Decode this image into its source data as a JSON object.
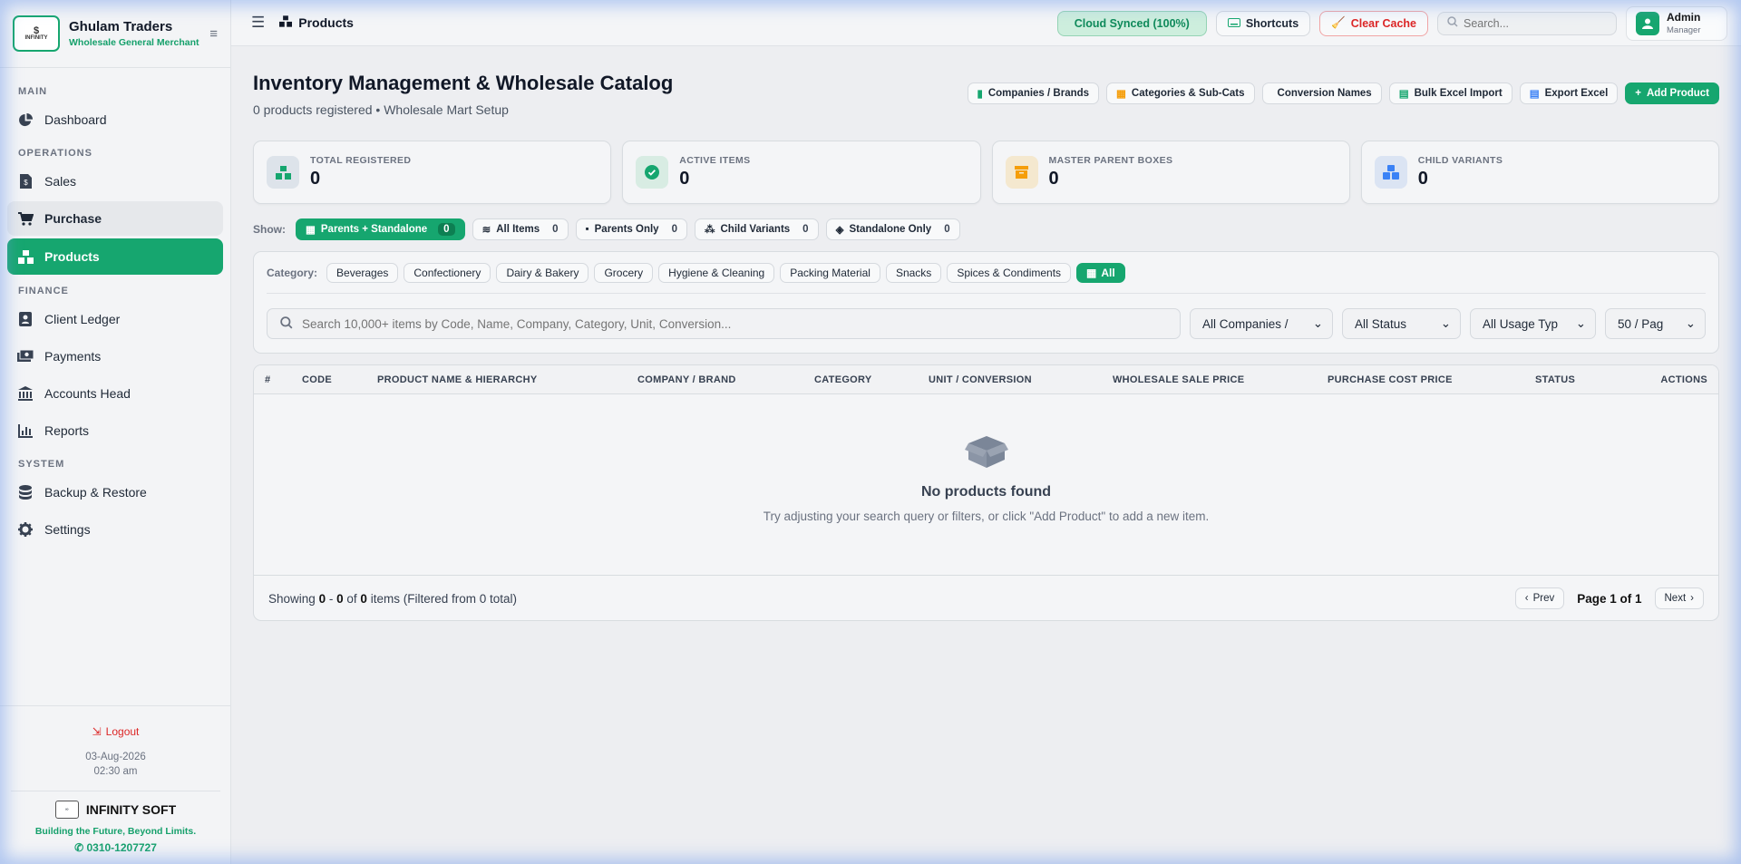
{
  "brand": {
    "name": "Ghulam Traders",
    "subtitle": "Wholesale General Merchant",
    "logo_text": "INFINITY"
  },
  "sidebar": {
    "sections": {
      "main": "MAIN",
      "operations": "OPERATIONS",
      "finance": "FINANCE",
      "system": "SYSTEM"
    },
    "items": {
      "dashboard": "Dashboard",
      "sales": "Sales",
      "purchase": "Purchase",
      "products": "Products",
      "client_ledger": "Client Ledger",
      "payments": "Payments",
      "accounts_head": "Accounts Head",
      "reports": "Reports",
      "backup": "Backup & Restore",
      "settings": "Settings"
    },
    "logout": "Logout",
    "date": "03-Aug-2026",
    "time": "02:30 am",
    "soft_name": "INFINITY SOFT",
    "soft_tagline": "Building the Future, Beyond Limits.",
    "soft_phone": "0310-1207727"
  },
  "topbar": {
    "title": "Products",
    "sync": "Cloud Synced (100%)",
    "shortcuts": "Shortcuts",
    "clear_cache": "Clear Cache",
    "search_placeholder": "Search...",
    "user_name": "Admin",
    "user_role": "Manager"
  },
  "page": {
    "title": "Inventory Management & Wholesale Catalog",
    "subtitle": "0 products registered • Wholesale Mart Setup",
    "actions": {
      "companies": "Companies / Brands",
      "categories": "Categories & Sub-Cats",
      "conversion": "Conversion Names",
      "bulk": "Bulk Excel Import",
      "export": "Export Excel",
      "add": "Add Product"
    }
  },
  "stats": {
    "total_label": "TOTAL REGISTERED",
    "total_value": "0",
    "active_label": "ACTIVE ITEMS",
    "active_value": "0",
    "parent_label": "MASTER PARENT BOXES",
    "parent_value": "0",
    "child_label": "CHILD VARIANTS",
    "child_value": "0"
  },
  "show_filter": {
    "label": "Show:",
    "options": [
      {
        "label": "Parents + Standalone",
        "count": "0"
      },
      {
        "label": "All Items",
        "count": "0"
      },
      {
        "label": "Parents Only",
        "count": "0"
      },
      {
        "label": "Child Variants",
        "count": "0"
      },
      {
        "label": "Standalone Only",
        "count": "0"
      }
    ]
  },
  "category_filter": {
    "label": "Category:",
    "chips": [
      "Beverages",
      "Confectionery",
      "Dairy & Bakery",
      "Grocery",
      "Hygiene & Cleaning",
      "Packing Material",
      "Snacks",
      "Spices & Condiments"
    ],
    "all": "All"
  },
  "search": {
    "placeholder": "Search 10,000+ items by Code, Name, Company, Category, Unit, Conversion...",
    "companies": "All Companies /",
    "status": "All Status",
    "usage": "All Usage Typ",
    "per_page": "50 / Pag"
  },
  "table": {
    "columns": [
      "#",
      "CODE",
      "PRODUCT NAME & HIERARCHY",
      "COMPANY / BRAND",
      "CATEGORY",
      "UNIT / CONVERSION",
      "WHOLESALE SALE PRICE",
      "PURCHASE COST PRICE",
      "STATUS",
      "ACTIONS"
    ],
    "empty_title": "No products found",
    "empty_sub": "Try adjusting your search query or filters, or click \"Add Product\" to add a new item."
  },
  "footer": {
    "showing": "Showing",
    "from": "0",
    "dash": "-",
    "to": "0",
    "of": "of",
    "total": "0",
    "items": "items (Filtered from 0 total)",
    "prev": "Prev",
    "page_info": "Page 1 of 1",
    "next": "Next"
  },
  "colors": {
    "accent": "#16a66f",
    "danger": "#dc2626",
    "orange": "#f59e0b",
    "blue": "#3b82f6"
  }
}
